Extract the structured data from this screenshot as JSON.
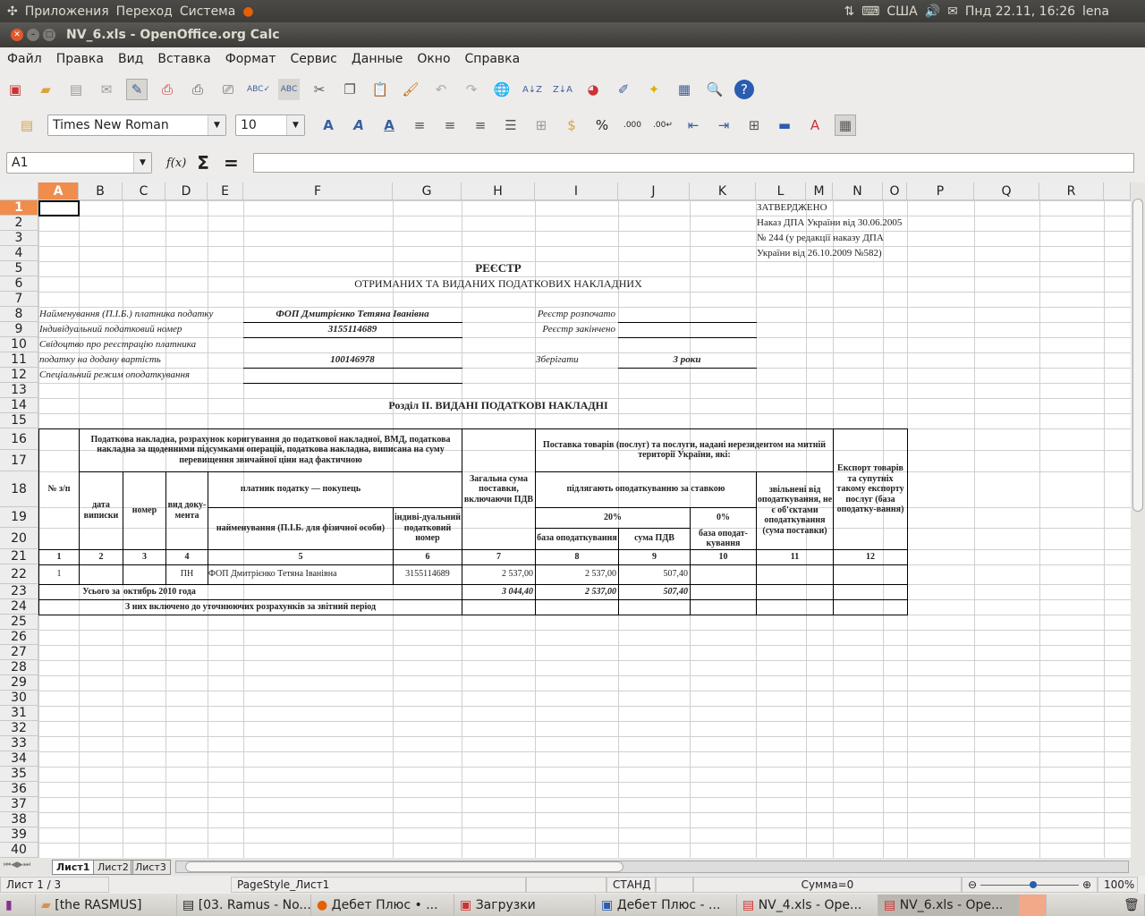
{
  "topbar": {
    "menus": [
      "Приложения",
      "Переход",
      "Система"
    ],
    "keyboard": "США",
    "datetime": "Пнд 22.11, 16:26",
    "user": "lena"
  },
  "window": {
    "title": "NV_6.xls - OpenOffice.org Calc"
  },
  "menu": [
    "Файл",
    "Правка",
    "Вид",
    "Вставка",
    "Формат",
    "Сервис",
    "Данные",
    "Окно",
    "Справка"
  ],
  "format": {
    "font": "Times New Roman",
    "size": "10"
  },
  "formula": {
    "cell_ref": "A1",
    "fx": "f(x)",
    "sum": "Σ",
    "eq": "=",
    "value": ""
  },
  "columns": [
    "A",
    "B",
    "C",
    "D",
    "E",
    "F",
    "G",
    "H",
    "I",
    "J",
    "K",
    "L",
    "M",
    "N",
    "O",
    "P",
    "Q",
    "R"
  ],
  "rows": [
    "1",
    "2",
    "3",
    "4",
    "5",
    "6",
    "7",
    "8",
    "9",
    "10",
    "11",
    "12",
    "13",
    "14",
    "15",
    "16",
    "17",
    "18",
    "19",
    "20",
    "21",
    "22",
    "23",
    "24",
    "25",
    "26",
    "27",
    "28",
    "29",
    "30",
    "31",
    "32",
    "33",
    "34",
    "35",
    "36",
    "37",
    "38",
    "39",
    "40"
  ],
  "sheet": {
    "approved": [
      "ЗАТВЕРДЖЕНО",
      "Наказ ДПА України від 30.06.2005",
      "№ 244 (у редакції наказу ДПА",
      "України від 26.10.2009 №582)"
    ],
    "title": "РЕЄСТР",
    "subtitle": "ОТРИМАНИХ ТА ВИДАНИХ ПОДАТКОВИХ НАКЛАДНИХ",
    "lbl_name": "Найменування (П.І.Б.) платника податку",
    "val_name": "ФОП Дмитрієнко Тетяна Іванівна",
    "lbl_inn": "Індивідуальний податковий номер",
    "val_inn": "3155114689",
    "lbl_cert1": "Свідоцтво про реєстрацію платника",
    "lbl_cert2": "податку на додану вартість",
    "val_cert": "100146978",
    "lbl_special": "Спеціальний режим оподаткування",
    "lbl_started": "Реєстр розпочато",
    "lbl_finished": "Реєстр закінчено",
    "lbl_keep": "Зберігати",
    "val_keep": "3 роки",
    "section": "Розділ II. ВИДАНІ ПОДАТКОВІ НАКЛАДНІ",
    "h_no": "№ з/п",
    "h_invoice": "Податкова накладна, розрахунок коригування до податкової накладної, ВМД, податкова накладна за щоденними підсумками операцій, податкова накладна, виписана на суму перевищення звичайної ціни над фактичною",
    "h_date": "дата виписки",
    "h_num": "номер",
    "h_type": "вид доку-мента",
    "h_buyer": "платник податку — покупець",
    "h_bname": "найменування (П.І.Б. для фізичної особи)",
    "h_binn": "індиві-дуальний податковий номер",
    "h_total": "Загальна сума поставки, включаючи ПДВ",
    "h_supply": "Поставка товарів (послуг) та послуги, надані нерезидентом на митній території України, які:",
    "h_taxed": "підлягають оподаткуванню за ставкою",
    "h_20": "20%",
    "h_0": "0%",
    "h_base": "база оподаткування",
    "h_vat": "сума ПДВ",
    "h_base0": "база оподат-кування",
    "h_exempt": "звільнені від оподаткування, не є об'єктами оподаткування (сума поставки)",
    "h_export": "Експорт товарів та супутніх такому експорту послуг (база оподатку-вання)",
    "colnums": [
      "1",
      "2",
      "3",
      "4",
      "5",
      "6",
      "7",
      "8",
      "9",
      "10",
      "11",
      "12"
    ],
    "row22": {
      "no": "1",
      "type": "ПН",
      "name": "ФОП Дмитрієнко Тетяна Іванівна",
      "inn": "3155114689",
      "total": "2 537,00",
      "base": "2 537,00",
      "vat": "507,40"
    },
    "row23": {
      "label": "Усього за",
      "period": "октябрь 2010 года",
      "total": "3 044,40",
      "base": "2 537,00",
      "vat": "507,40"
    },
    "row24": "З них включено до уточнюючих розрахунків за звітний період"
  },
  "sheets": [
    "Лист1",
    "Лист2",
    "Лист3"
  ],
  "status": {
    "sheet": "Лист 1 / 3",
    "style": "PageStyle_Лист1",
    "mode": "СТАНД",
    "sum": "Сумма=0",
    "zoom": "100%",
    "zoom_level": 100
  },
  "taskbar": [
    "[the RASMUS]",
    "[03. Ramus - No...",
    "Дебет Плюс • ...",
    "Загрузки",
    "Дебет Плюс - ...",
    "NV_4.xls - Ope...",
    "NV_6.xls - Ope..."
  ]
}
